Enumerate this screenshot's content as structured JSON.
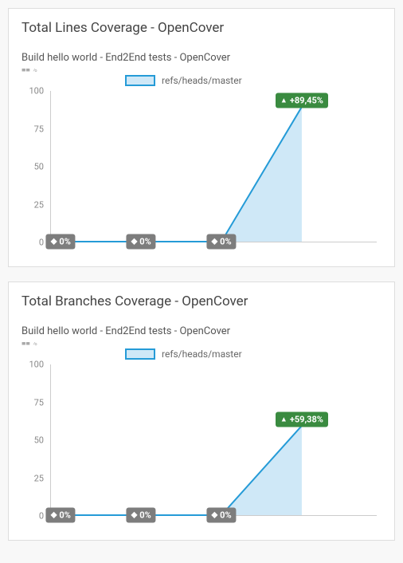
{
  "chart_data": [
    {
      "type": "area",
      "title": "Total Lines Coverage - OpenCover",
      "subtitle": "Build hello world - End2End tests - OpenCover",
      "legend": "refs/heads/master",
      "ylim": [
        0,
        100
      ],
      "yticks": [
        0,
        25,
        50,
        75,
        100
      ],
      "x": [
        0,
        1,
        2,
        3
      ],
      "values": [
        0,
        0,
        0,
        89.45
      ],
      "point_labels": [
        "0%",
        "0%",
        "0%",
        "+89,45%"
      ],
      "point_styles": [
        "gray",
        "gray",
        "gray",
        "green"
      ]
    },
    {
      "type": "area",
      "title": "Total Branches Coverage - OpenCover",
      "subtitle": "Build hello world - End2End tests - OpenCover",
      "legend": "refs/heads/master",
      "ylim": [
        0,
        100
      ],
      "yticks": [
        0,
        25,
        50,
        75,
        100
      ],
      "x": [
        0,
        1,
        2,
        3
      ],
      "values": [
        0,
        0,
        0,
        59.38
      ],
      "point_labels": [
        "0%",
        "0%",
        "0%",
        "+59,38%"
      ],
      "point_styles": [
        "gray",
        "gray",
        "gray",
        "green"
      ]
    }
  ],
  "clipped_text": "■■ %"
}
